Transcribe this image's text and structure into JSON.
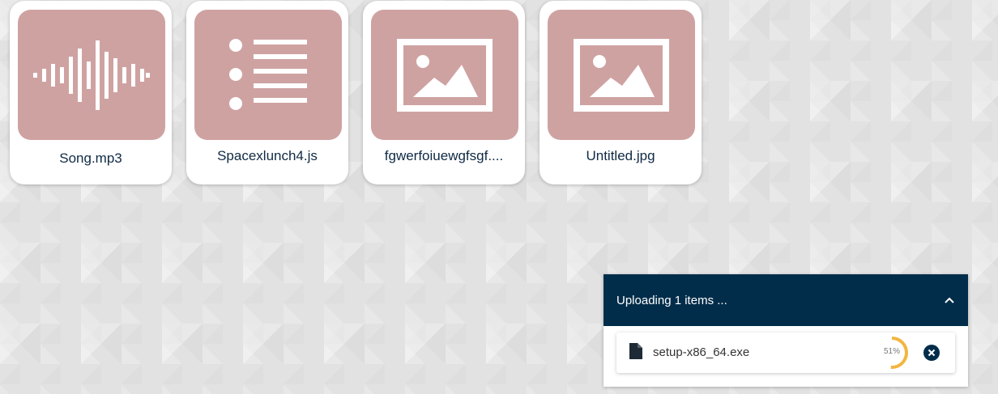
{
  "files": [
    {
      "name": "Song.mp3",
      "icon": "audio-waveform-icon"
    },
    {
      "name": "Spacexlunch4.js",
      "icon": "list-document-icon"
    },
    {
      "name": "fgwerfoiuewgfsgf....",
      "icon": "image-icon"
    },
    {
      "name": "Untitled.jpg",
      "icon": "image-icon"
    }
  ],
  "upload_panel": {
    "title": "Uploading 1 items ...",
    "collapse_icon": "chevron-up-icon",
    "items": [
      {
        "name": "setup-x86_64.exe",
        "icon": "file-icon",
        "progress_percent": 51,
        "progress_label": "51%",
        "cancel_icon": "close-circle-icon"
      }
    ]
  },
  "colors": {
    "thumb": "#cfa2a2",
    "panel_header": "#022d4a",
    "progress": "#f3b53f",
    "file_name_text": "#0f2a44"
  }
}
